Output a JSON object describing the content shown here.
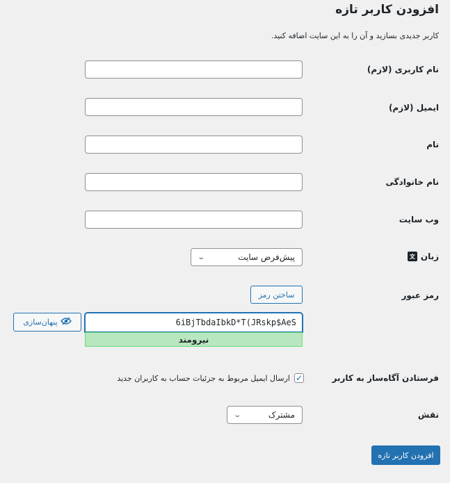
{
  "header": {
    "title": "افزودن کاربر تازه",
    "description": "کاربر جدیدی بسازید و آن را به این سایت اضافه کنید."
  },
  "fields": {
    "username_label": "نام کاربری (لازم)",
    "email_label": "ایمیل (لازم)",
    "first_name_label": "نام",
    "last_name_label": "نام خانوادگی",
    "website_label": "وب سایت",
    "language_label": "زبان",
    "language_value": "پیش‌فرض سایت",
    "password_label": "رمز عبور",
    "generate_password": "ساختن رمز",
    "password_value": "6iBjTbdaIbkD*T(JRskp$AeS",
    "hide_label": "پنهان‌سازی",
    "strength": "نیرومند",
    "notify_label": "فرستادن آگاه‌ساز به کاربر",
    "notify_text": "ارسال ایمیل مربوط به جزئیات حساب به کاربران جدید",
    "role_label": "نقش",
    "role_value": "مشترک"
  },
  "actions": {
    "submit": "افزودن کاربر تازه"
  }
}
